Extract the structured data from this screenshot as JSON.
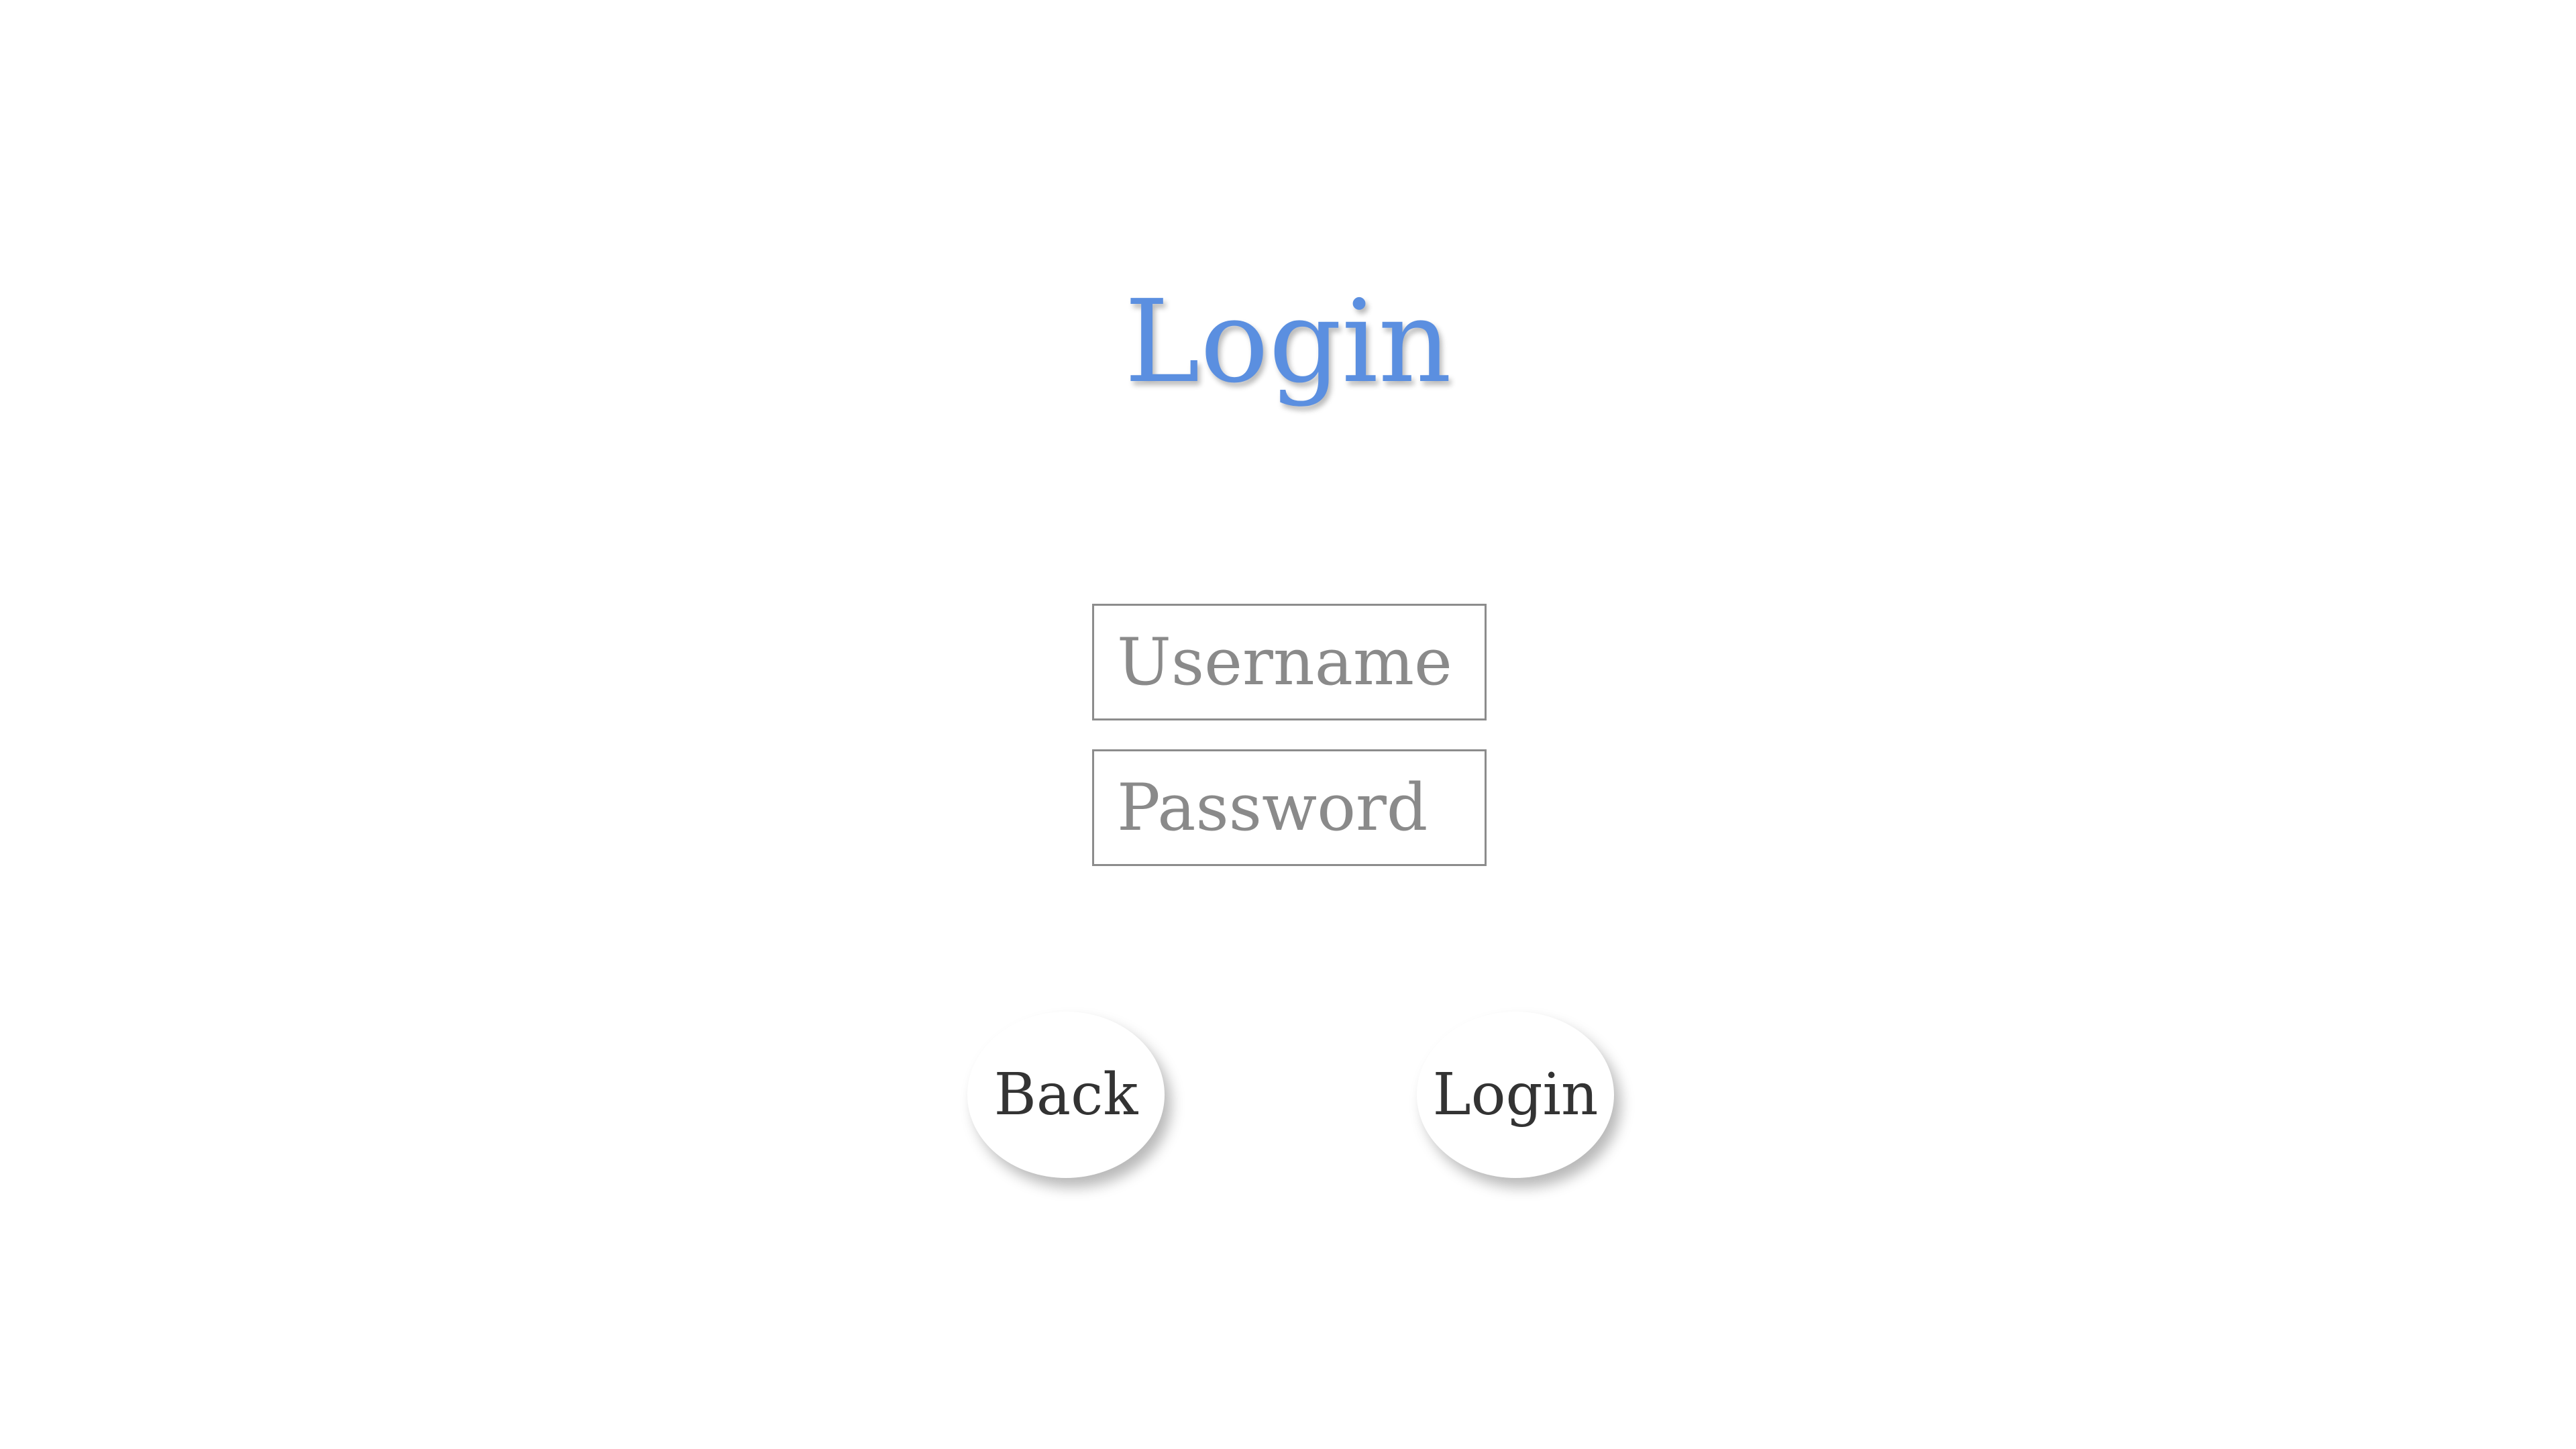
{
  "page": {
    "title": "Login"
  },
  "form": {
    "username_placeholder": "Username",
    "username_value": "",
    "password_placeholder": "Password",
    "password_value": ""
  },
  "actions": {
    "back_label": "Back",
    "login_label": "Login"
  },
  "colors": {
    "title": "#5b8fe0",
    "background": "#ffffff",
    "field_border": "#8c8c8c",
    "button_text": "#333333"
  }
}
